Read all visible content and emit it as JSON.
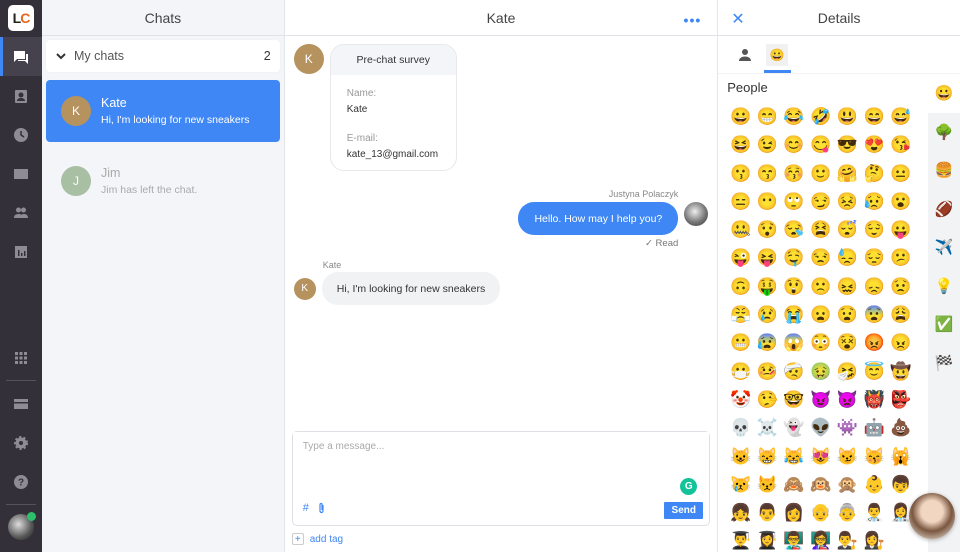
{
  "nav": {
    "logo": {
      "l": "L",
      "c": "C"
    },
    "items": [
      "chats",
      "customers",
      "archives",
      "tickets",
      "team",
      "reports"
    ],
    "bottom_items": [
      "apps",
      "billing",
      "settings",
      "help"
    ]
  },
  "chats_panel": {
    "title": "Chats",
    "group": {
      "label": "My chats",
      "count": "2"
    },
    "items": [
      {
        "initial": "K",
        "name": "Kate",
        "preview": "Hi, I'm looking for new sneakers",
        "avatar_color": "#b5925e",
        "active": true
      },
      {
        "initial": "J",
        "name": "Jim",
        "preview": "Jim has left the chat.",
        "avatar_color": "#a8bfa4",
        "active": false
      }
    ]
  },
  "conversation": {
    "title": "Kate",
    "more": "•••",
    "survey": {
      "avatar_initial": "K",
      "title": "Pre-chat survey",
      "name_label": "Name:",
      "name_value": "Kate",
      "email_label": "E-mail:",
      "email_value": "kate_13@gmail.com"
    },
    "agent_message": {
      "author": "Justyna Polaczyk",
      "text": "Hello. How may I help you?",
      "status": "✓ Read"
    },
    "visitor_message": {
      "author": "Kate",
      "initial": "K",
      "text": "Hi, I'm looking for new sneakers"
    },
    "composer": {
      "placeholder": "Type a message...",
      "send_label": "Send",
      "grammarly": "G",
      "hash": "#",
      "attach": "📎"
    },
    "add_tag": {
      "plus": "+",
      "label": "add tag"
    }
  },
  "details": {
    "title": "Details",
    "close": "✕",
    "tabs": [
      "person",
      "emoji"
    ],
    "emoji_section": "People",
    "emojis": [
      "😀",
      "😁",
      "😂",
      "🤣",
      "😃",
      "😄",
      "😅",
      "😆",
      "😉",
      "😊",
      "😋",
      "😎",
      "😍",
      "😘",
      "😗",
      "😙",
      "😚",
      "🙂",
      "🤗",
      "🤔",
      "😐",
      "😑",
      "😶",
      "🙄",
      "😏",
      "😣",
      "😥",
      "😮",
      "🤐",
      "😯",
      "😪",
      "😫",
      "😴",
      "😌",
      "😛",
      "😜",
      "😝",
      "🤤",
      "😒",
      "😓",
      "😔",
      "😕",
      "🙃",
      "🤑",
      "😲",
      "🙁",
      "😖",
      "😞",
      "😟",
      "😤",
      "😢",
      "😭",
      "😦",
      "😧",
      "😨",
      "😩",
      "😬",
      "😰",
      "😱",
      "😳",
      "😵",
      "😡",
      "😠",
      "😷",
      "🤒",
      "🤕",
      "🤢",
      "🤧",
      "😇",
      "🤠",
      "🤡",
      "🤥",
      "🤓",
      "😈",
      "👿",
      "👹",
      "👺",
      "💀",
      "☠️",
      "👻",
      "👽",
      "👾",
      "🤖",
      "💩",
      "😺",
      "😸",
      "😹",
      "😻",
      "😼",
      "😽",
      "🙀",
      "😿",
      "😾",
      "🙈",
      "🙉",
      "🙊",
      "👶",
      "👦",
      "👧",
      "👨",
      "👩",
      "👴",
      "👵",
      "👨‍⚕️",
      "👩‍⚕️",
      "👨‍🎓",
      "👩‍🎓",
      "👨‍🏫",
      "👩‍🏫",
      "👨‍⚖️",
      "👩‍⚖️"
    ],
    "categories": [
      "😀",
      "🌳",
      "🍔",
      "🏈",
      "✈️",
      "💡",
      "✅",
      "🏁"
    ]
  }
}
